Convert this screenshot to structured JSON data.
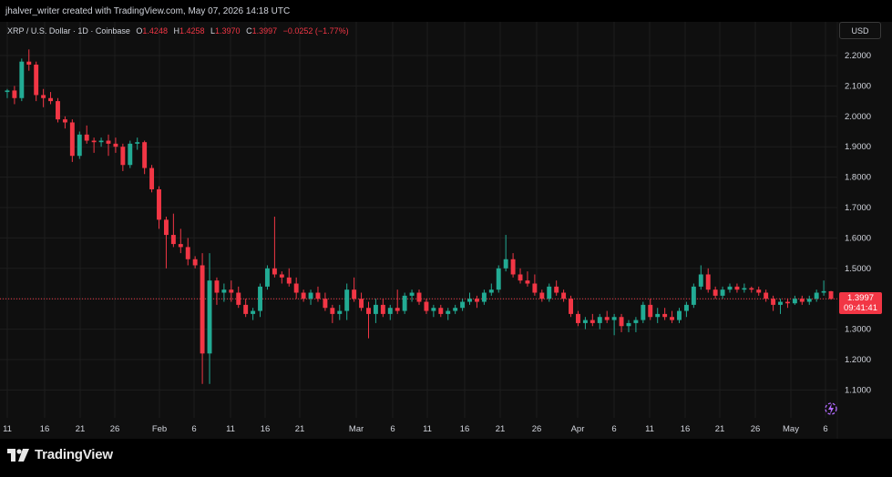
{
  "header": {
    "credit": "jhalver_writer created with TradingView.com, May 07, 2026 14:18 UTC"
  },
  "symbol": {
    "name": "XRP / U.S. Dollar · 1D · Coinbase",
    "o_label": "O",
    "o_value": "1.4248",
    "h_label": "H",
    "h_value": "1.4258",
    "l_label": "L",
    "l_value": "1.3970",
    "c_label": "C",
    "c_value": "1.3997",
    "change": "−0.0252 (−1.77%)"
  },
  "currency_button": "USD",
  "last_price": {
    "value": "1.3997",
    "countdown": "09:41:41"
  },
  "brand": {
    "name": "TradingView"
  },
  "colors": {
    "up": "#22ab94",
    "down": "#f23645",
    "background": "#0f0f0f",
    "grid": "#1e1e1e",
    "axis_text": "#d1d4dc"
  },
  "icons": {
    "brand_logo": "tradingview-logo-icon",
    "alert": "lightning-icon"
  },
  "chart_data": {
    "type": "candlestick",
    "title": "XRP / U.S. Dollar · 1D · Coinbase",
    "x_tick_labels": [
      "11",
      "16",
      "21",
      "26",
      "Feb",
      "6",
      "11",
      "16",
      "21",
      "Mar",
      "6",
      "11",
      "16",
      "21",
      "26",
      "Apr",
      "6",
      "11",
      "16",
      "21",
      "26",
      "May",
      "6"
    ],
    "y_tick_labels": [
      "2.2000",
      "2.1000",
      "2.0000",
      "1.9000",
      "1.8000",
      "1.7000",
      "1.6000",
      "1.5000",
      "1.4000",
      "1.3000",
      "1.2000",
      "1.1000"
    ],
    "ylim": [
      1.03,
      2.25
    ],
    "grid": true,
    "last_close": 1.3997,
    "candles": [
      [
        1.4248,
        1.4258,
        1.397,
        1.3997
      ]
    ]
  }
}
